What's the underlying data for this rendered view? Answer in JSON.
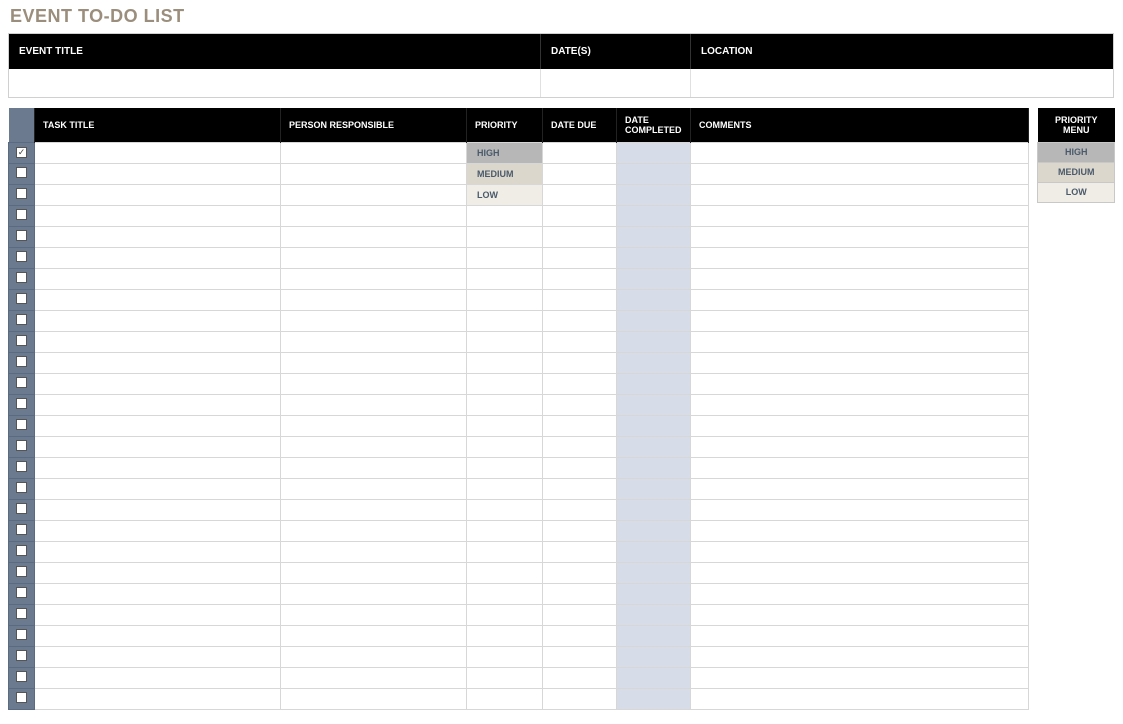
{
  "title": "EVENT TO-DO LIST",
  "event_header": {
    "title_label": "EVENT TITLE",
    "dates_label": "DATE(S)",
    "location_label": "LOCATION",
    "title_value": "",
    "dates_value": "",
    "location_value": ""
  },
  "task_headers": {
    "task_title": "TASK TITLE",
    "person": "PERSON RESPONSIBLE",
    "priority": "PRIORITY",
    "date_due": "DATE DUE",
    "date_completed": "DATE COMPLETED",
    "comments": "COMMENTS"
  },
  "priority_levels": {
    "high": "HIGH",
    "medium": "MEDIUM",
    "low": "LOW"
  },
  "priority_menu_header": "PRIORITY MENU",
  "tasks": [
    {
      "checked": true,
      "title": "",
      "person": "",
      "priority": "HIGH",
      "date_due": "",
      "date_completed": "",
      "comments": ""
    },
    {
      "checked": false,
      "title": "",
      "person": "",
      "priority": "MEDIUM",
      "date_due": "",
      "date_completed": "",
      "comments": ""
    },
    {
      "checked": false,
      "title": "",
      "person": "",
      "priority": "LOW",
      "date_due": "",
      "date_completed": "",
      "comments": ""
    },
    {
      "checked": false,
      "title": "",
      "person": "",
      "priority": "",
      "date_due": "",
      "date_completed": "",
      "comments": ""
    },
    {
      "checked": false,
      "title": "",
      "person": "",
      "priority": "",
      "date_due": "",
      "date_completed": "",
      "comments": ""
    },
    {
      "checked": false,
      "title": "",
      "person": "",
      "priority": "",
      "date_due": "",
      "date_completed": "",
      "comments": ""
    },
    {
      "checked": false,
      "title": "",
      "person": "",
      "priority": "",
      "date_due": "",
      "date_completed": "",
      "comments": ""
    },
    {
      "checked": false,
      "title": "",
      "person": "",
      "priority": "",
      "date_due": "",
      "date_completed": "",
      "comments": ""
    },
    {
      "checked": false,
      "title": "",
      "person": "",
      "priority": "",
      "date_due": "",
      "date_completed": "",
      "comments": ""
    },
    {
      "checked": false,
      "title": "",
      "person": "",
      "priority": "",
      "date_due": "",
      "date_completed": "",
      "comments": ""
    },
    {
      "checked": false,
      "title": "",
      "person": "",
      "priority": "",
      "date_due": "",
      "date_completed": "",
      "comments": ""
    },
    {
      "checked": false,
      "title": "",
      "person": "",
      "priority": "",
      "date_due": "",
      "date_completed": "",
      "comments": ""
    },
    {
      "checked": false,
      "title": "",
      "person": "",
      "priority": "",
      "date_due": "",
      "date_completed": "",
      "comments": ""
    },
    {
      "checked": false,
      "title": "",
      "person": "",
      "priority": "",
      "date_due": "",
      "date_completed": "",
      "comments": ""
    },
    {
      "checked": false,
      "title": "",
      "person": "",
      "priority": "",
      "date_due": "",
      "date_completed": "",
      "comments": ""
    },
    {
      "checked": false,
      "title": "",
      "person": "",
      "priority": "",
      "date_due": "",
      "date_completed": "",
      "comments": ""
    },
    {
      "checked": false,
      "title": "",
      "person": "",
      "priority": "",
      "date_due": "",
      "date_completed": "",
      "comments": ""
    },
    {
      "checked": false,
      "title": "",
      "person": "",
      "priority": "",
      "date_due": "",
      "date_completed": "",
      "comments": ""
    },
    {
      "checked": false,
      "title": "",
      "person": "",
      "priority": "",
      "date_due": "",
      "date_completed": "",
      "comments": ""
    },
    {
      "checked": false,
      "title": "",
      "person": "",
      "priority": "",
      "date_due": "",
      "date_completed": "",
      "comments": ""
    },
    {
      "checked": false,
      "title": "",
      "person": "",
      "priority": "",
      "date_due": "",
      "date_completed": "",
      "comments": ""
    },
    {
      "checked": false,
      "title": "",
      "person": "",
      "priority": "",
      "date_due": "",
      "date_completed": "",
      "comments": ""
    },
    {
      "checked": false,
      "title": "",
      "person": "",
      "priority": "",
      "date_due": "",
      "date_completed": "",
      "comments": ""
    },
    {
      "checked": false,
      "title": "",
      "person": "",
      "priority": "",
      "date_due": "",
      "date_completed": "",
      "comments": ""
    },
    {
      "checked": false,
      "title": "",
      "person": "",
      "priority": "",
      "date_due": "",
      "date_completed": "",
      "comments": ""
    },
    {
      "checked": false,
      "title": "",
      "person": "",
      "priority": "",
      "date_due": "",
      "date_completed": "",
      "comments": ""
    },
    {
      "checked": false,
      "title": "",
      "person": "",
      "priority": "",
      "date_due": "",
      "date_completed": "",
      "comments": ""
    }
  ]
}
